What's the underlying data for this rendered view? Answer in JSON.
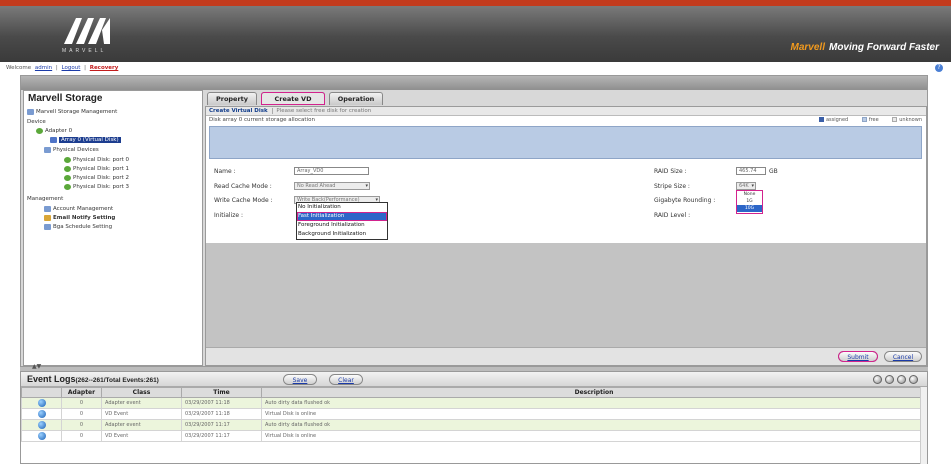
{
  "banner": {
    "logo_text": "MARVELL",
    "tagline_brand": "Marvell",
    "tagline": "Moving Forward Faster"
  },
  "linkbar": {
    "prefix": "Welcome",
    "user": "admin",
    "logout": "Logout",
    "extra": "Recovery"
  },
  "tree": {
    "title": "Marvell Storage",
    "items": [
      {
        "label": "Marvell Storage Management"
      },
      {
        "label": "Device"
      },
      {
        "label": "Adapter 0"
      },
      {
        "label": "Array 0 (Virtual Disk)"
      },
      {
        "label": "Physical Devices"
      },
      {
        "label": "Physical Disk: port 0"
      },
      {
        "label": "Physical Disk: port 1"
      },
      {
        "label": "Physical Disk: port 2"
      },
      {
        "label": "Physical Disk: port 3"
      },
      {
        "label": "Management"
      },
      {
        "label": "Account Management"
      },
      {
        "label": "Email Notify Setting"
      },
      {
        "label": "Bga Schedule Setting"
      }
    ]
  },
  "tabs": [
    {
      "label": "Property"
    },
    {
      "label": "Create VD"
    },
    {
      "label": "Operation"
    }
  ],
  "subtabs": {
    "active": "Create Virtual Disk",
    "inactive": "Please select free disk for creation"
  },
  "info": {
    "text": "Disk array 0 current storage allocation",
    "legend": [
      "assigned",
      "free",
      "unknown"
    ],
    "legend_colors": [
      "#3a5fa8",
      "#b9cbe4",
      "#e9e9e9"
    ]
  },
  "form": {
    "name_label": "Name :",
    "name_value": "Array_VD0",
    "read_cache_label": "Read Cache Mode :",
    "read_cache_value": "No Read Ahead",
    "write_cache_label": "Write Cache Mode :",
    "write_cache_value": "Write Back(Performance)",
    "initialize_label": "Initialize :",
    "init_options": [
      "No Initialization",
      "Fast Initialization",
      "Foreground Initialization",
      "Background Initialization"
    ],
    "raid_size_label": "RAID Size :",
    "raid_size_value": "465.74",
    "raid_size_unit": "GB",
    "stripe_label": "Stripe Size :",
    "stripe_value": "64K",
    "gigabyte_label": "Gigabyte Rounding :",
    "gigabyte_options": [
      "None",
      "1G",
      "10G"
    ],
    "raid_level_label": "RAID Level :"
  },
  "buttons": {
    "submit": "Submit",
    "cancel": "Cancel"
  },
  "eventlog": {
    "title": "Event Logs",
    "count": "(262--261/Total Events:261)",
    "save": "Save",
    "clear": "Clear",
    "columns": [
      "Adapter",
      "Class",
      "Time",
      "Description"
    ],
    "rows": [
      {
        "adapter": "0",
        "class": "Adapter event",
        "time": "03/29/2007 11:18",
        "desc": "Auto dirty data flushed ok"
      },
      {
        "adapter": "0",
        "class": "VD Event",
        "time": "03/29/2007 11:18",
        "desc": "Virtual Disk is online"
      },
      {
        "adapter": "0",
        "class": "Adapter event",
        "time": "03/29/2007 11:17",
        "desc": "Auto dirty data flushed ok"
      },
      {
        "adapter": "0",
        "class": "VD Event",
        "time": "03/29/2007 11:17",
        "desc": "Virtual Disk is online"
      }
    ]
  }
}
